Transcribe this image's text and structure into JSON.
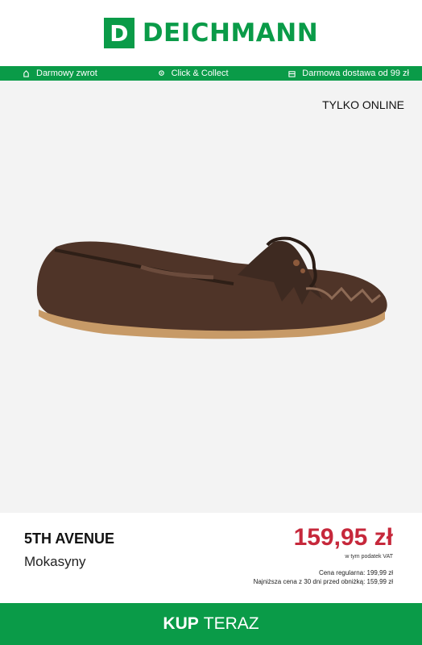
{
  "header": {
    "logo_letter": "D",
    "logo_text": "DEICHMANN",
    "brand_color": "#0a9b48"
  },
  "benefits": [
    {
      "icon": "return-icon",
      "label": "Darmowy zwrot"
    },
    {
      "icon": "location-pin-icon",
      "label": "Click & Collect"
    },
    {
      "icon": "delivery-box-icon",
      "label": "Darmowa dostawa od 99 zł"
    }
  ],
  "product": {
    "tag": "TYLKO ONLINE",
    "brand": "5TH AVENUE",
    "category": "Mokasyny",
    "price": "159,95 zł",
    "vat_note": "w tym podatek VAT",
    "regular_price": "Cena regularna: 199,99 zł",
    "lowest_price": "Najniższa cena z 30 dni przed obniżką: 159,99 zł",
    "price_color": "#c6283b"
  },
  "cta": {
    "bold": "KUP",
    "rest": "TERAZ"
  }
}
